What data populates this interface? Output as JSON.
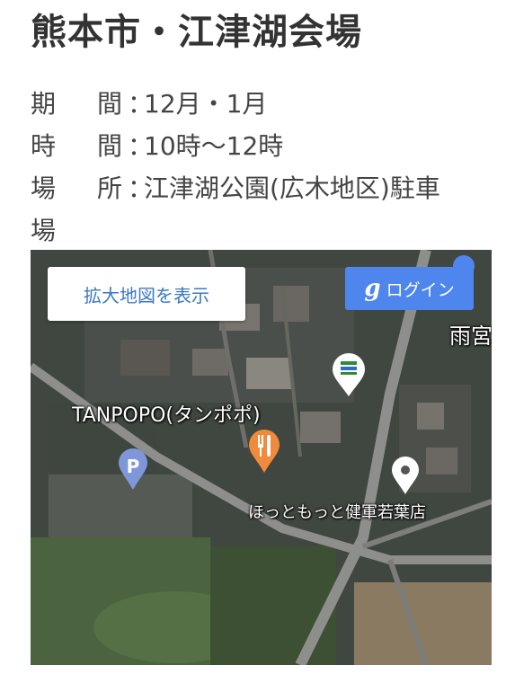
{
  "title": "熊本市・江津湖会場",
  "info": [
    {
      "label_a": "期",
      "label_b": "間",
      "sep": "：",
      "value": "12月・1月"
    },
    {
      "label_a": "時",
      "label_b": "間",
      "sep": "：",
      "value": "10時〜12時"
    },
    {
      "label_a": "場",
      "label_b": "所",
      "sep": "：",
      "value": "江津湖公園(広木地区)駐車",
      "value_wrap": "場"
    }
  ],
  "map": {
    "expand_label": "拡大地図を表示",
    "login_icon": "g",
    "login_label": "ログイン",
    "labels": {
      "restaurant": "TANPOPO(タンポポ)",
      "shop": "ほっともっと健軍若葉店",
      "area_cut": "雨宮"
    },
    "icons": [
      "parking-pin-icon",
      "restaurant-pin-icon",
      "store-pin-icon",
      "location-pin-icon",
      "user-pin-icon"
    ],
    "colors": {
      "parking_pin": "#7f97d8",
      "restaurant_pin": "#f08a3c",
      "store_pin": "#ffffff",
      "location_pin": "#ffffff",
      "login_button": "#4e86ed",
      "expand_text": "#3b78c3"
    }
  }
}
